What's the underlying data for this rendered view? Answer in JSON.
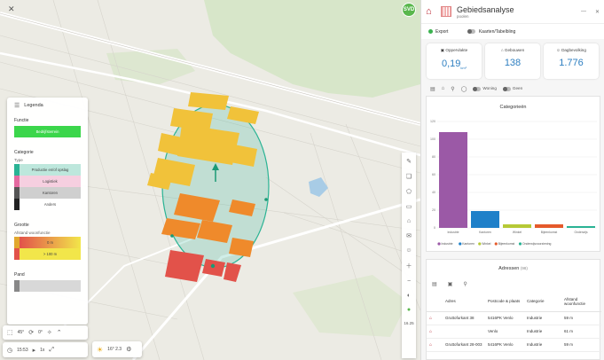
{
  "map": {
    "avatar_initials": "SVD",
    "legend": {
      "title": "Legenda",
      "sections": [
        {
          "title": "Functie",
          "items": [
            {
              "label": "Bedrijfsterrein",
              "color": "#3bd64b"
            }
          ]
        },
        {
          "title": "Categorie",
          "subtitle": "Type",
          "items": [
            {
              "label": "Productie en/of opslag",
              "color": "#2ab394",
              "bg": "#bde7dc"
            },
            {
              "label": "Logistiek",
              "color": "#e56aa1",
              "bg": "#f6cfe0"
            },
            {
              "label": "Kantoren",
              "color": "#555555",
              "bg": "#cfcfcf"
            },
            {
              "label": "Anders",
              "color": "#222222",
              "bg": "#ffffff"
            }
          ]
        },
        {
          "title": "Grootte",
          "subtitle": "Afstand woonfunctie",
          "items": [
            {
              "label": "0 m",
              "color": "#e2a82e",
              "bg": "#f5d6a4"
            },
            {
              "label": "> 100 m",
              "color": "#e2524a",
              "bg": "#f2e64a"
            }
          ]
        },
        {
          "title": "Pand",
          "items": [
            {
              "label": "",
              "color": "#888888",
              "bg": "#d8d8d8"
            }
          ]
        }
      ]
    },
    "toolbar": {
      "view_angle": "45°",
      "view_pitch": "0°",
      "time": "15:53",
      "slider_val": "1x",
      "sun_label": "16°  2.3"
    },
    "strip_zoom": "16.25"
  },
  "panel": {
    "title": "Gebiedsanalyse",
    "subtitle": "poolen",
    "export_label": "Export",
    "toggle_label": "Kaarten/Tabelbling",
    "kpis": [
      {
        "label": "Oppervlakte",
        "value": "0,19",
        "unit": "km²"
      },
      {
        "label": "Gebouwen",
        "value": "138",
        "unit": ""
      },
      {
        "label": "Dagbevolking",
        "value": "1.776",
        "unit": ""
      }
    ],
    "filters": [
      {
        "label": "Woning"
      },
      {
        "label": "Geen"
      }
    ],
    "chart_title": "Categorieën",
    "address_title": "Adressen",
    "address_count": "(98)",
    "table": {
      "headers": [
        "Adres",
        "Postcode & plaats",
        "Categorie",
        "Afstand woonfunctie"
      ],
      "rows": [
        [
          "Gruttofurkant 38",
          "5416PK Venlo",
          "Industrie",
          "59 m"
        ],
        [
          "",
          "Venlo",
          "Industrie",
          "61 m"
        ],
        [
          "Gruttofurkant 28-003",
          "5416PK Venlo",
          "Industrie",
          "59 m"
        ]
      ]
    }
  },
  "chart_data": {
    "type": "bar",
    "title": "Categorieën",
    "categories": [
      "Industrie",
      "Kantoren",
      "Winkel",
      "Bijeenkomst",
      "Onderwijs"
    ],
    "values": [
      108,
      19,
      4,
      4,
      2
    ],
    "colors": [
      "#9b59a6",
      "#1f80c9",
      "#b6c936",
      "#e55a2b",
      "#2ab394"
    ],
    "ylim": [
      0,
      120
    ],
    "yticks": [
      0,
      20,
      40,
      60,
      80,
      100,
      120
    ],
    "legend": [
      "Industrie",
      "Kantoren",
      "Winkel",
      "Bijeenkomst",
      "Onderwijsvoorziening"
    ],
    "legend_position": "bottom",
    "grid": true
  }
}
